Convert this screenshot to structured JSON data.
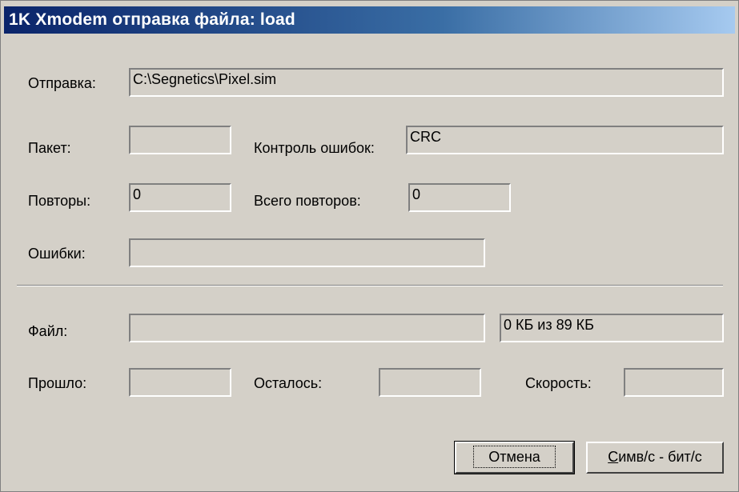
{
  "window": {
    "title": "1K Xmodem отправка файла: load"
  },
  "send": {
    "label": "Отправка:",
    "value": "C:\\Segnetics\\Pixel.sim"
  },
  "packet": {
    "label": "Пакет:",
    "value": ""
  },
  "error_check": {
    "label": "Контроль ошибок:",
    "value": "CRC"
  },
  "retries": {
    "label": "Повторы:",
    "value": "0"
  },
  "total_retries": {
    "label": "Всего повторов:",
    "value": "0"
  },
  "errors": {
    "label": "Ошибки:",
    "value": ""
  },
  "file": {
    "label": "Файл:",
    "progress": 0,
    "size_text": "0 КБ из 89 КБ"
  },
  "elapsed": {
    "label": "Прошло:",
    "value": ""
  },
  "remaining": {
    "label": "Осталось:",
    "value": ""
  },
  "speed": {
    "label": "Скорость:",
    "value": ""
  },
  "buttons": {
    "cancel": "Отмена",
    "units": "Симв/с - бит/с"
  }
}
